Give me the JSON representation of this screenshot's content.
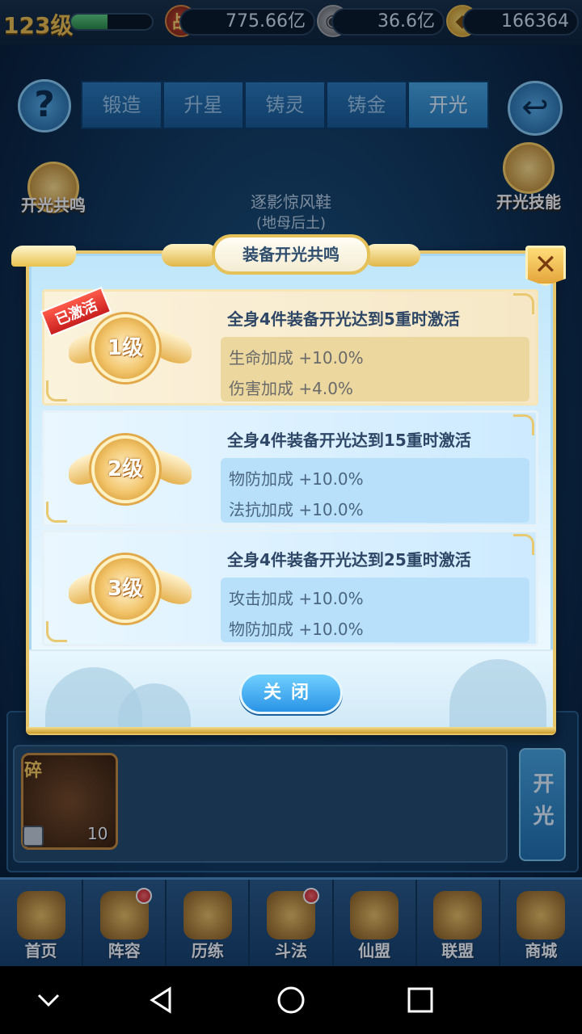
{
  "status": {
    "level": "123级",
    "power_icon": "战",
    "power": "775.66亿",
    "coin_icon": "coin-icon",
    "coins": "36.6亿",
    "ingot_icon": "ingot-icon",
    "ingots": "166364"
  },
  "tabs": [
    {
      "label": "锻造"
    },
    {
      "label": "升星"
    },
    {
      "label": "铸灵"
    },
    {
      "label": "铸金"
    },
    {
      "label": "开光"
    }
  ],
  "side": {
    "left_badge": "开光共鸣",
    "right_badge": "开光技能"
  },
  "equipment": {
    "name": "逐影惊风鞋",
    "subtitle": "(地母后土)"
  },
  "dialog": {
    "title": "装备开光共鸣",
    "close_x": "✕",
    "tiers": [
      {
        "badge": "已激活",
        "medal": "1级",
        "requirement": "全身4件装备开光达到5重时激活",
        "bonuses": [
          "生命加成 +10.0%",
          "伤害加成 +4.0%"
        ]
      },
      {
        "medal": "2级",
        "requirement": "全身4件装备开光达到15重时激活",
        "bonuses": [
          "物防加成 +10.0%",
          "法抗加成 +10.0%"
        ]
      },
      {
        "medal": "3级",
        "requirement": "全身4件装备开光达到25重时激活",
        "bonuses": [
          "攻击加成 +10.0%",
          "物防加成 +10.0%"
        ]
      }
    ],
    "close_button": "关闭"
  },
  "bottom": {
    "item_tag": "碎",
    "item_count": "10",
    "open_button": "开光"
  },
  "nav": [
    {
      "label": "首页"
    },
    {
      "label": "阵容"
    },
    {
      "label": "历练"
    },
    {
      "label": "斗法"
    },
    {
      "label": "仙盟"
    },
    {
      "label": "联盟"
    },
    {
      "label": "商城"
    }
  ],
  "colors": {
    "accent_gold": "#e7c56a",
    "button_blue": "#2b93e6",
    "active_badge_red": "#c81e1e"
  }
}
